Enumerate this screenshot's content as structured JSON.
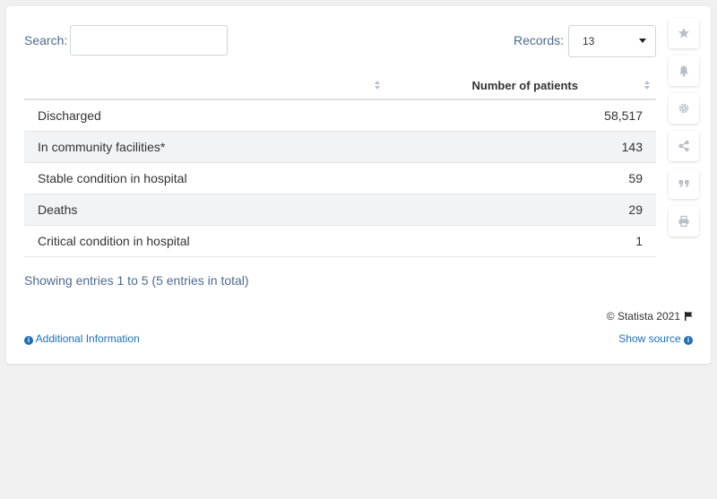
{
  "search": {
    "label": "Search:",
    "value": ""
  },
  "records": {
    "label": "Records:",
    "value": "13"
  },
  "chart_data": {
    "type": "table",
    "columns": [
      "",
      "Number of patients"
    ],
    "rows": [
      {
        "label": "Discharged",
        "value": "58,517"
      },
      {
        "label": "In community facilities*",
        "value": "143"
      },
      {
        "label": "Stable condition in hospital",
        "value": "59"
      },
      {
        "label": "Deaths",
        "value": "29"
      },
      {
        "label": "Critical condition in hospital",
        "value": "1"
      }
    ]
  },
  "info_text": "Showing entries 1 to 5 (5 entries in total)",
  "footer": {
    "copyright": "© Statista 2021",
    "additional_info": "Additional Information",
    "show_source": "Show source"
  },
  "sidebar_icons": [
    "star-icon",
    "bell-icon",
    "gear-icon",
    "share-icon",
    "quote-icon",
    "print-icon"
  ],
  "colors": {
    "link": "#1f6fb5",
    "label": "#4d6a8f",
    "row_alt": "#f1f3f5",
    "icon": "#b9bfc7"
  }
}
